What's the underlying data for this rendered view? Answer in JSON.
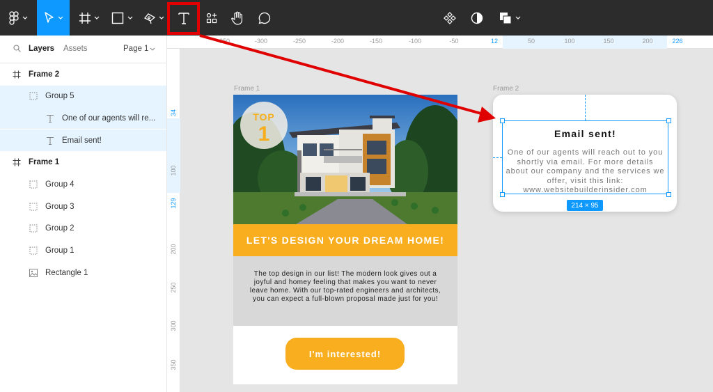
{
  "toolbar": {
    "tools": [
      "figma-menu",
      "move",
      "frame",
      "shape",
      "pen",
      "text",
      "resources",
      "hand",
      "comment"
    ],
    "active_tool": "move",
    "highlighted_tool": "text"
  },
  "layers_panel": {
    "tab_layers": "Layers",
    "tab_assets": "Assets",
    "page_label": "Page 1",
    "items": [
      {
        "label": "Frame 2",
        "type": "frame",
        "indent": 0
      },
      {
        "label": "Group 5",
        "type": "group",
        "indent": 1,
        "selected": true
      },
      {
        "label": "One of our agents will re...",
        "type": "text",
        "indent": 2
      },
      {
        "label": "Email sent!",
        "type": "text",
        "indent": 2
      },
      {
        "label": "Frame 1",
        "type": "frame",
        "indent": 0
      },
      {
        "label": "Group 4",
        "type": "group",
        "indent": 1
      },
      {
        "label": "Group 3",
        "type": "group",
        "indent": 1
      },
      {
        "label": "Group 2",
        "type": "group",
        "indent": 1
      },
      {
        "label": "Group 1",
        "type": "group",
        "indent": 1
      },
      {
        "label": "Rectangle 1",
        "type": "image",
        "indent": 1
      }
    ]
  },
  "ruler_top": {
    "ticks": [
      "-350",
      "-300",
      "-250",
      "-200",
      "-150",
      "-100",
      "-50",
      "12",
      "50",
      "100",
      "150",
      "200",
      "226"
    ],
    "highlight": [
      "12",
      "226"
    ]
  },
  "ruler_left": {
    "ticks": [
      "34",
      "100",
      "129",
      "200",
      "250",
      "300",
      "350"
    ],
    "highlight": [
      "34",
      "129"
    ]
  },
  "canvas": {
    "frame1_label": "Frame 1",
    "frame2_label": "Frame 2",
    "badge_top": "TOP",
    "badge_num": "1",
    "banner_text": "LET'S DESIGN YOUR DREAM HOME!",
    "description": "The top design in our list! The modern look gives out a joyful and homey feeling that makes you want to never leave home. With our top-rated engineers and architects, you can expect a full-blown proposal made just for you!",
    "cta_label": "I'm interested!",
    "email_title": "Email sent!",
    "email_body": "One of our agents will reach out to you shortly via email. For more details about our company and the services we offer, visit this link: www.websitebuilderinsider.com",
    "selection_size": "214 × 95"
  },
  "colors": {
    "accent": "#0d99ff",
    "brand_orange": "#f8ae1f",
    "toolbar_bg": "#2c2c2c",
    "annotation_red": "#e00000"
  }
}
